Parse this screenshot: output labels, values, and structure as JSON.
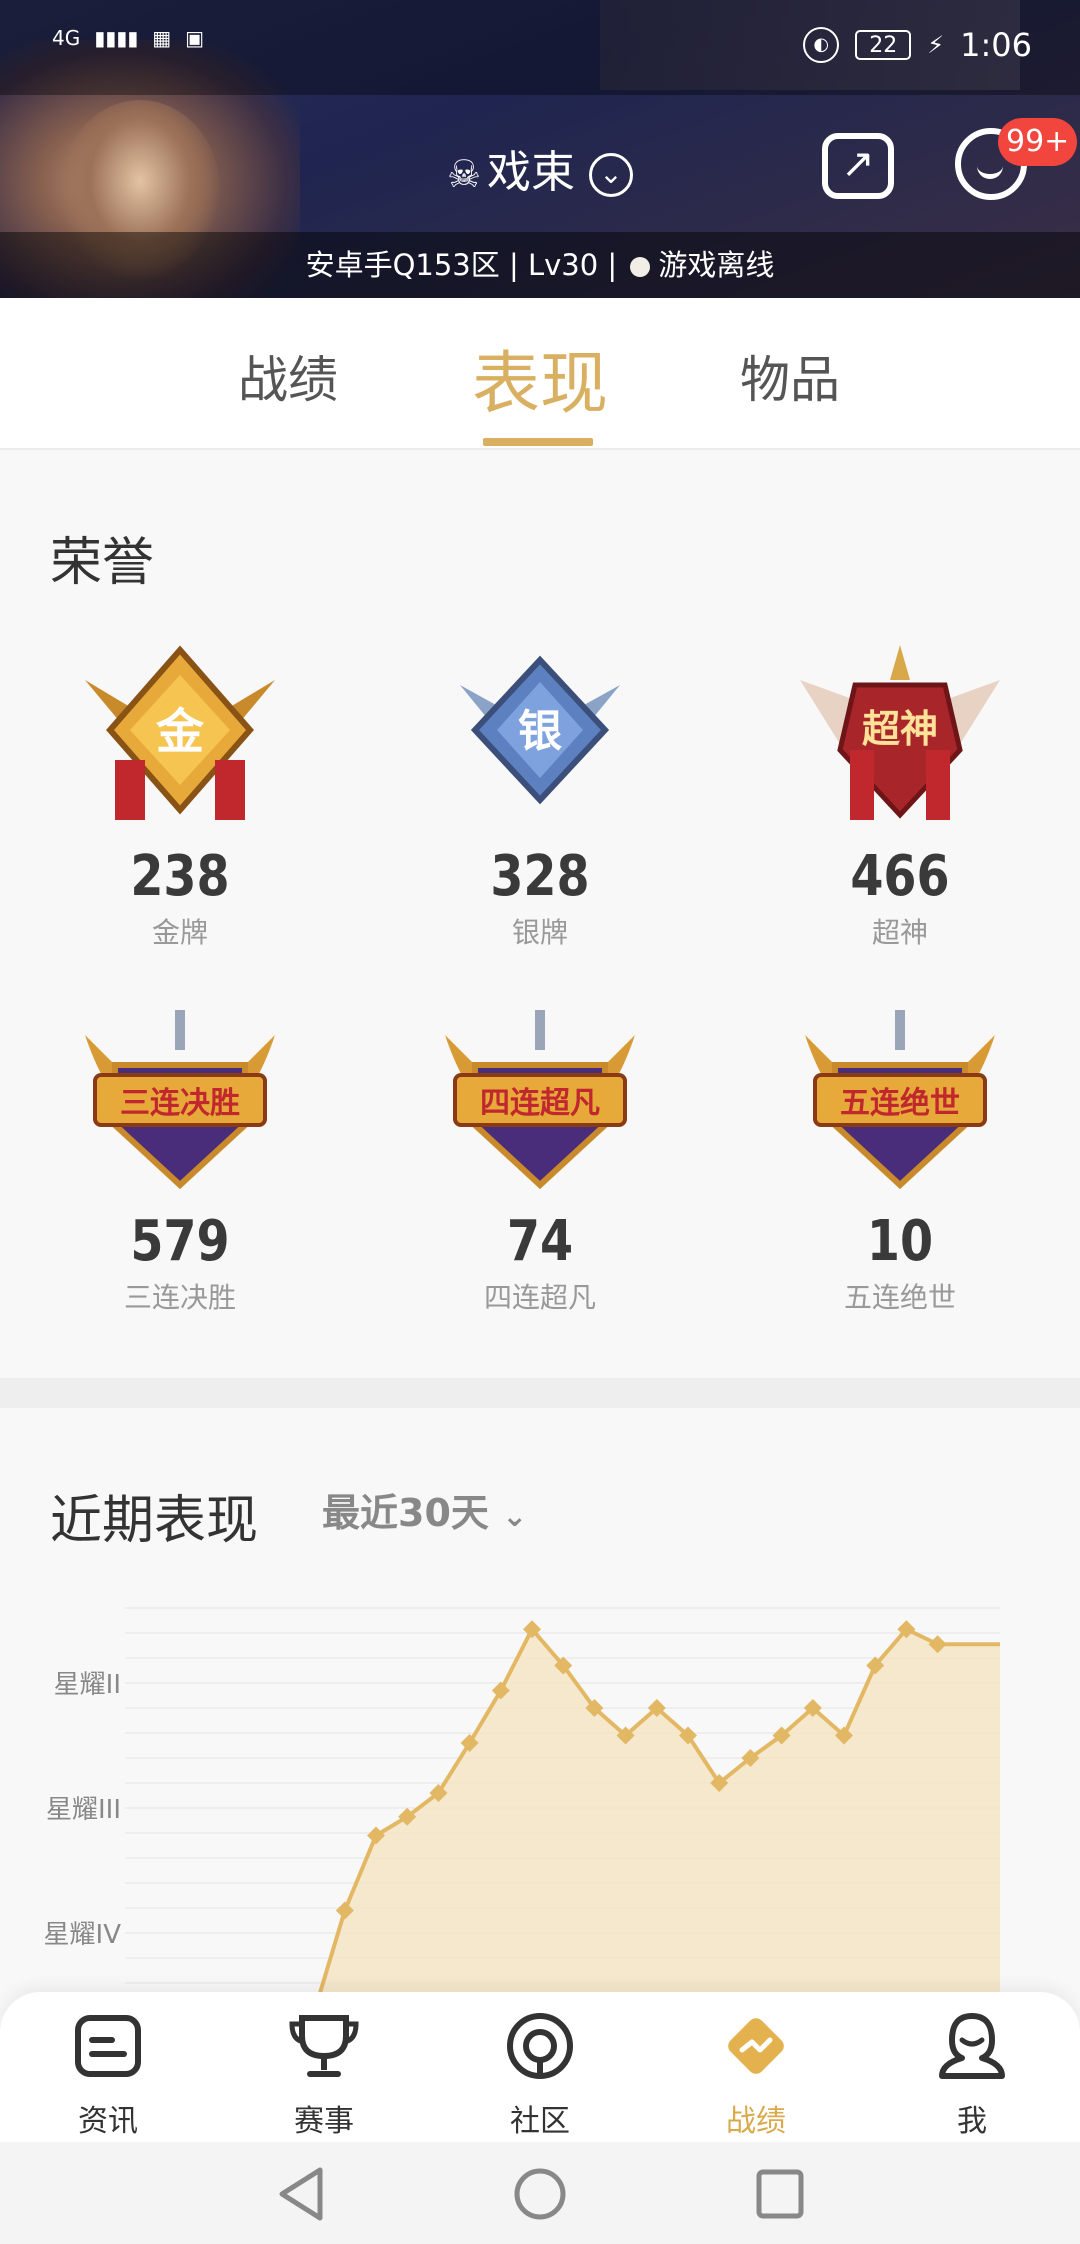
{
  "status_bar": {
    "network": "4G",
    "battery": "22",
    "time": "1:06"
  },
  "profile": {
    "skull": "☠",
    "name": "戏束",
    "share_icon": "share-icon",
    "message_badge": "99+",
    "subline_left": "安卓手Q153区 | Lv30 |",
    "status_text": "游戏离线"
  },
  "tabs": [
    {
      "label": "战绩",
      "active": false
    },
    {
      "label": "表现",
      "active": true
    },
    {
      "label": "物品",
      "active": false
    }
  ],
  "honor": {
    "title": "荣誉",
    "medals": [
      {
        "icon_text": "金",
        "count": "238",
        "label": "金牌"
      },
      {
        "icon_text": "银",
        "count": "328",
        "label": "银牌"
      },
      {
        "icon_text": "超神",
        "count": "466",
        "label": "超神"
      },
      {
        "icon_text": "三连决胜",
        "count": "579",
        "label": "三连决胜"
      },
      {
        "icon_text": "四连超凡",
        "count": "74",
        "label": "四连超凡"
      },
      {
        "icon_text": "五连绝世",
        "count": "10",
        "label": "五连绝世"
      }
    ]
  },
  "performance": {
    "title": "近期表现",
    "range_label": "最近30天"
  },
  "chart_data": {
    "type": "area",
    "title": "",
    "xlabel": "",
    "ylabel": "",
    "y_tick_labels": [
      "星耀II",
      "星耀III",
      "星耀IV"
    ],
    "y_tick_values": [
      2,
      1,
      0
    ],
    "ylim": [
      -0.6,
      2.6
    ],
    "x": [
      1,
      2,
      3,
      4,
      5,
      6,
      7,
      8,
      9,
      10,
      11,
      12,
      13,
      14,
      15,
      16,
      17,
      18,
      19,
      20,
      21,
      22,
      23,
      24,
      25,
      26
    ],
    "values": [
      -0.65,
      -0.65,
      -0.65,
      -0.65,
      0.18,
      0.78,
      0.93,
      1.12,
      1.52,
      1.94,
      2.43,
      2.14,
      1.8,
      1.58,
      1.8,
      1.58,
      1.2,
      1.4,
      1.58,
      1.8,
      1.58,
      2.14,
      2.43,
      2.31,
      2.31,
      2.31
    ],
    "grid": true,
    "color": "#e3b865",
    "fill": "#f5e3bd"
  },
  "bottom_nav": [
    {
      "label": "资讯",
      "icon": "news-icon",
      "active": false
    },
    {
      "label": "赛事",
      "icon": "trophy-icon",
      "active": false
    },
    {
      "label": "社区",
      "icon": "community-icon",
      "active": false
    },
    {
      "label": "战绩",
      "icon": "stats-icon",
      "active": true
    },
    {
      "label": "我",
      "icon": "profile-icon",
      "active": false
    }
  ],
  "colors": {
    "accent": "#d9b062",
    "badge": "#f2453d"
  }
}
